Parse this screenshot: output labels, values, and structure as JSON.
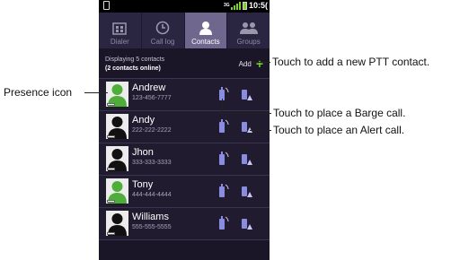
{
  "status_bar": {
    "network_label": "3G",
    "time": "10:5("
  },
  "tabs": [
    {
      "label": "Dialer",
      "icon": "dialer-icon",
      "active": false
    },
    {
      "label": "Call log",
      "icon": "clock-icon",
      "active": false
    },
    {
      "label": "Contacts",
      "icon": "person-icon",
      "active": true
    },
    {
      "label": "Groups",
      "icon": "group-icon",
      "active": false
    }
  ],
  "header": {
    "displaying": "Displaying 5 contacts",
    "online": "(2 contacts online)",
    "add_label": "Add",
    "add_icon": "+"
  },
  "contacts": [
    {
      "name": "Andrew",
      "phone": "123-456-7777",
      "online": true
    },
    {
      "name": "Andy",
      "phone": "222-222-2222",
      "online": false
    },
    {
      "name": "Jhon",
      "phone": "333-333-3333",
      "online": false
    },
    {
      "name": "Tony",
      "phone": "444-444-4444",
      "online": true
    },
    {
      "name": "Williams",
      "phone": "555-555-5555",
      "online": false
    }
  ],
  "annotations": {
    "presence": "Presence icon",
    "add": "Touch to add a new PTT contact.",
    "barge": "Touch to place a Barge call.",
    "alert": "Touch to place an Alert call."
  },
  "colors": {
    "online": "#4fae3a",
    "offline": "#111111",
    "accent_green": "#74d12a",
    "active_tab": "#6f678e"
  }
}
